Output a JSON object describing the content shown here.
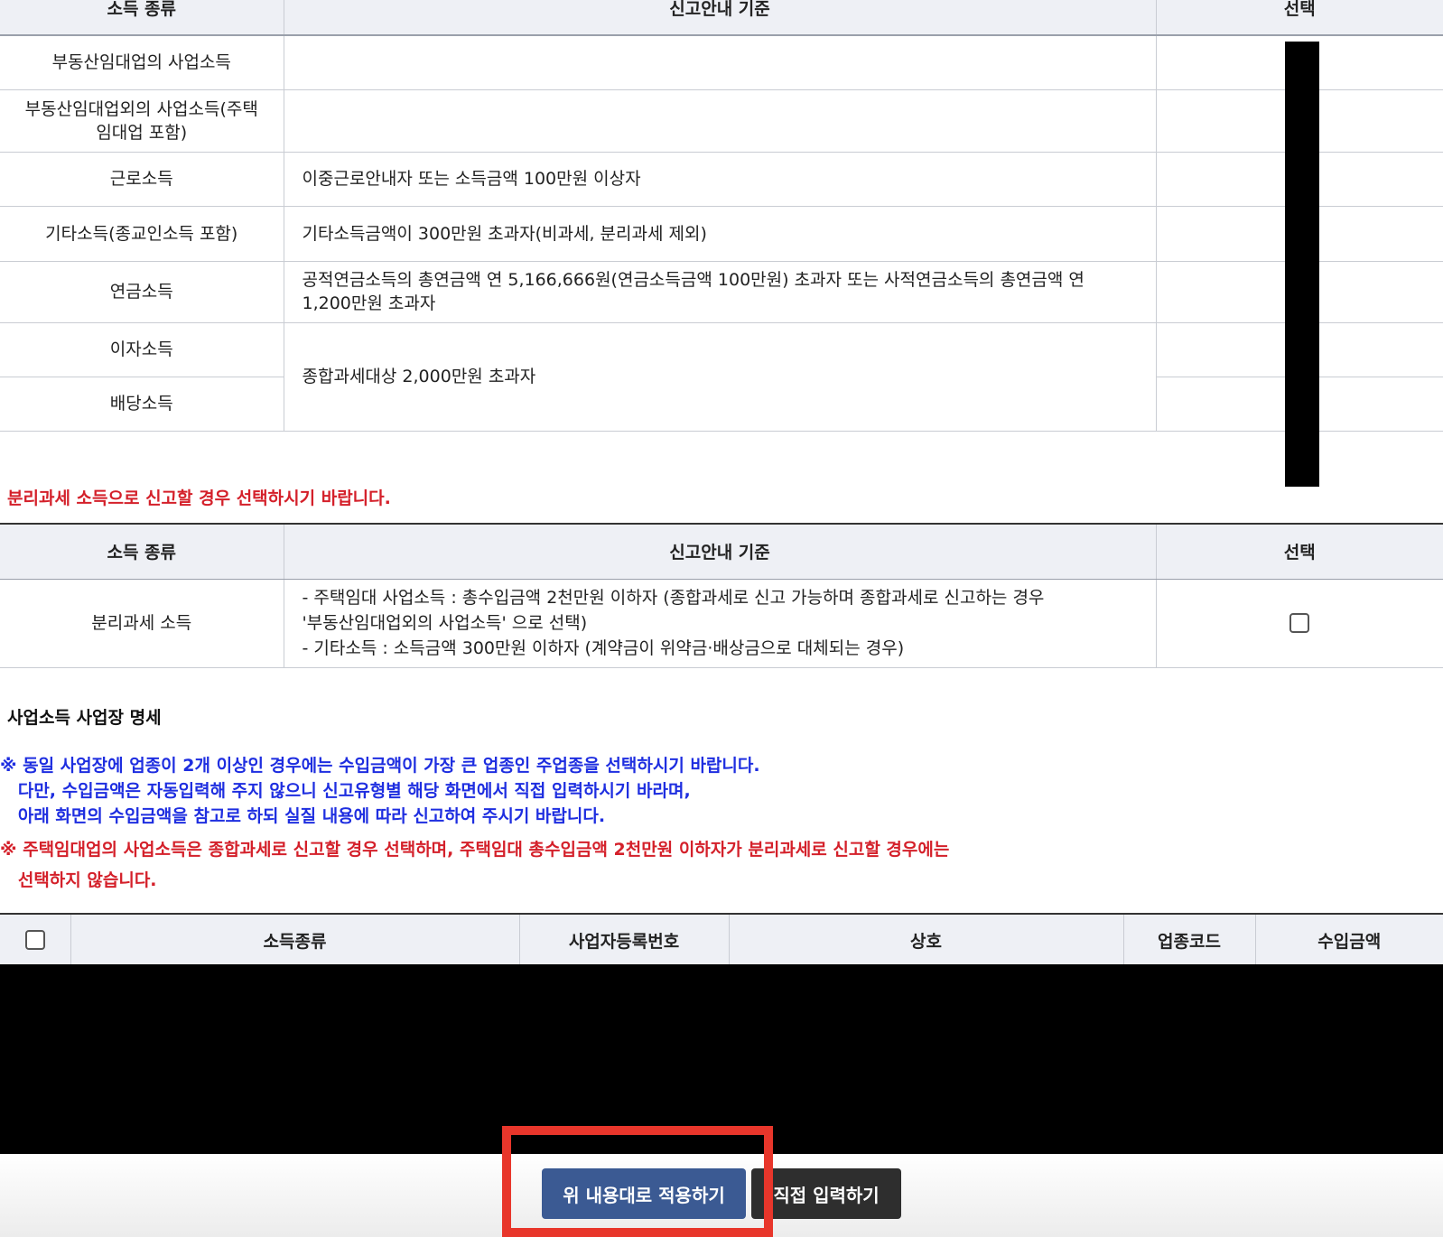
{
  "table1": {
    "headers": [
      "소득 종류",
      "신고안내 기준",
      "선택"
    ],
    "rows": [
      {
        "type": "부동산임대업의 사업소득",
        "criteria": ""
      },
      {
        "type": "부동산임대업외의 사업소득(주택임대업 포함)",
        "criteria": ""
      },
      {
        "type": "근로소득",
        "criteria": "이중근로안내자 또는 소득금액 100만원 이상자"
      },
      {
        "type": "기타소득(종교인소득 포함)",
        "criteria": "기타소득금액이 300만원 초과자(비과세, 분리과세 제외)"
      },
      {
        "type": "연금소득",
        "criteria": "공적연금소득의 총연금액 연 5,166,666원(연금소득금액 100만원) 초과자 또는 사적연금소득의 총연금액 연 1,200만원 초과자"
      },
      {
        "type": "이자소득",
        "criteria": "종합과세대상 2,000만원 초과자"
      },
      {
        "type": "배당소득",
        "criteria": ""
      }
    ]
  },
  "separate_tax_notice": "분리과세 소득으로 신고할 경우 선택하시기 바랍니다.",
  "table2": {
    "headers": [
      "소득 종류",
      "신고안내 기준",
      "선택"
    ],
    "row": {
      "type": "분리과세 소득",
      "line1": "- 주택임대 사업소득 : 총수입금액 2천만원 이하자 (종합과세로 신고 가능하며 종합과세로 신고하는 경우",
      "line2": "'부동산임대업외의 사업소득' 으로 선택)",
      "line3": "- 기타소득 : 소득금액 300만원 이하자 (계약금이 위약금·배상금으로 대체되는 경우)"
    }
  },
  "business_section": {
    "title": "사업소득 사업장 명세",
    "blue_note": "※ 동일 사업장에 업종이 2개 이상인 경우에는 수입금액이 가장 큰 업종인 주업종을 선택하시기 바랍니다.\n   다만, 수입금액은 자동입력해 주지 않으니 신고유형별 해당 화면에서 직접 입력하시기 바라며,\n   아래 화면의 수입금액을 참고로 하되 실질 내용에 따라 신고하여 주시기 바랍니다.",
    "red_note": "※ 주택임대업의 사업소득은 종합과세로 신고할 경우 선택하며, 주택임대 총수입금액 2천만원 이하자가 분리과세로 신고할 경우에는\n   선택하지 않습니다."
  },
  "table3": {
    "headers": [
      "소득종류",
      "사업자등록번호",
      "상호",
      "업종코드",
      "수입금액"
    ]
  },
  "buttons": {
    "apply": "위 내용대로 적용하기",
    "direct": "직접 입력하기"
  },
  "colors": {
    "notice_red": "#d4202a",
    "notice_blue": "#1e2ee0",
    "apply_button": "#3b5a93",
    "direct_button": "#2e2e2e",
    "highlight": "#e8362b"
  }
}
